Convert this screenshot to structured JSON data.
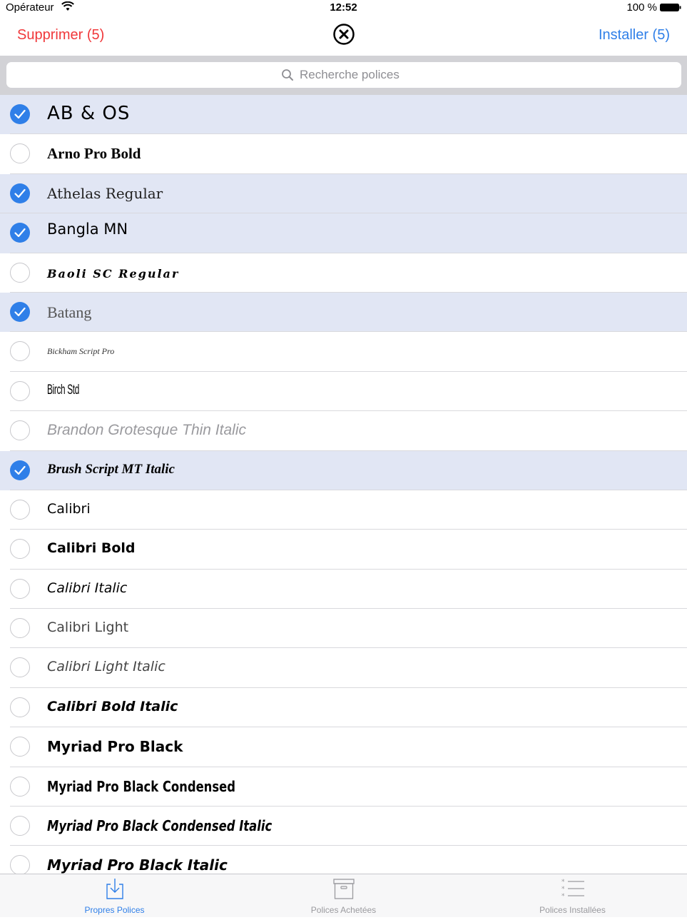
{
  "status_bar": {
    "carrier": "Opérateur",
    "time": "12:52",
    "battery": "100 %"
  },
  "nav": {
    "delete_label": "Supprimer (5)",
    "install_label": "Installer (5)"
  },
  "search": {
    "placeholder": "Recherche polices"
  },
  "fonts": [
    {
      "name": "AB & OS",
      "selected": true
    },
    {
      "name": "Arno Pro Bold",
      "selected": false
    },
    {
      "name": "Athelas Regular",
      "selected": true
    },
    {
      "name": "Bangla MN",
      "selected": true
    },
    {
      "name": "Baoli SC Regular",
      "selected": false
    },
    {
      "name": "Batang",
      "selected": true
    },
    {
      "name": "Bickham Script Pro",
      "selected": false
    },
    {
      "name": "Birch Std",
      "selected": false
    },
    {
      "name": "Brandon Grotesque Thin Italic",
      "selected": false
    },
    {
      "name": "Brush Script MT Italic",
      "selected": true
    },
    {
      "name": "Calibri",
      "selected": false
    },
    {
      "name": "Calibri Bold",
      "selected": false
    },
    {
      "name": "Calibri Italic",
      "selected": false
    },
    {
      "name": "Calibri Light",
      "selected": false
    },
    {
      "name": "Calibri Light Italic",
      "selected": false
    },
    {
      "name": "Calibri Bold Italic",
      "selected": false
    },
    {
      "name": "Myriad Pro Black",
      "selected": false
    },
    {
      "name": "Myriad Pro Black Condensed",
      "selected": false
    },
    {
      "name": "Myriad Pro Black Condensed Italic",
      "selected": false
    },
    {
      "name": "Myriad Pro Black Italic",
      "selected": false
    }
  ],
  "tabs": [
    {
      "label": "Propres Polices",
      "icon": "download-tray-icon",
      "active": true
    },
    {
      "label": "Polices Achetées",
      "icon": "archive-box-icon",
      "active": false
    },
    {
      "label": "Polices Installées",
      "icon": "list-icon",
      "active": false
    }
  ],
  "colors": {
    "accent": "#2f7fe8",
    "destructive": "#f0383a",
    "selected_row": "#e1e6f4"
  }
}
